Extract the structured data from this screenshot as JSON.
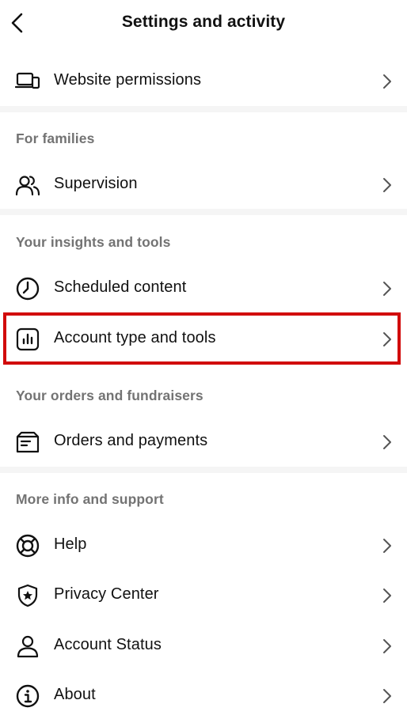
{
  "header": {
    "title": "Settings and activity",
    "back_icon": "chevron-left-icon"
  },
  "sections": [
    {
      "label": "",
      "items": [
        {
          "label": "Website permissions",
          "icon": "devices-icon"
        }
      ]
    },
    {
      "label": "For families",
      "items": [
        {
          "label": "Supervision",
          "icon": "people-icon"
        }
      ]
    },
    {
      "label": "Your insights and tools",
      "items": [
        {
          "label": "Scheduled content",
          "icon": "clock-icon"
        },
        {
          "label": "Account type and tools",
          "icon": "bar-chart-icon"
        }
      ]
    },
    {
      "label": "Your orders and fundraisers",
      "items": [
        {
          "label": "Orders and payments",
          "icon": "receipt-icon"
        }
      ]
    },
    {
      "label": "More info and support",
      "items": [
        {
          "label": "Help",
          "icon": "lifebuoy-icon"
        },
        {
          "label": "Privacy Center",
          "icon": "shield-star-icon"
        },
        {
          "label": "Account Status",
          "icon": "person-icon"
        },
        {
          "label": "About",
          "icon": "info-icon"
        }
      ]
    }
  ],
  "colors": {
    "text": "#111111",
    "section_label": "#737373",
    "divider": "#f5f5f5",
    "highlight": "#d10a0a"
  }
}
